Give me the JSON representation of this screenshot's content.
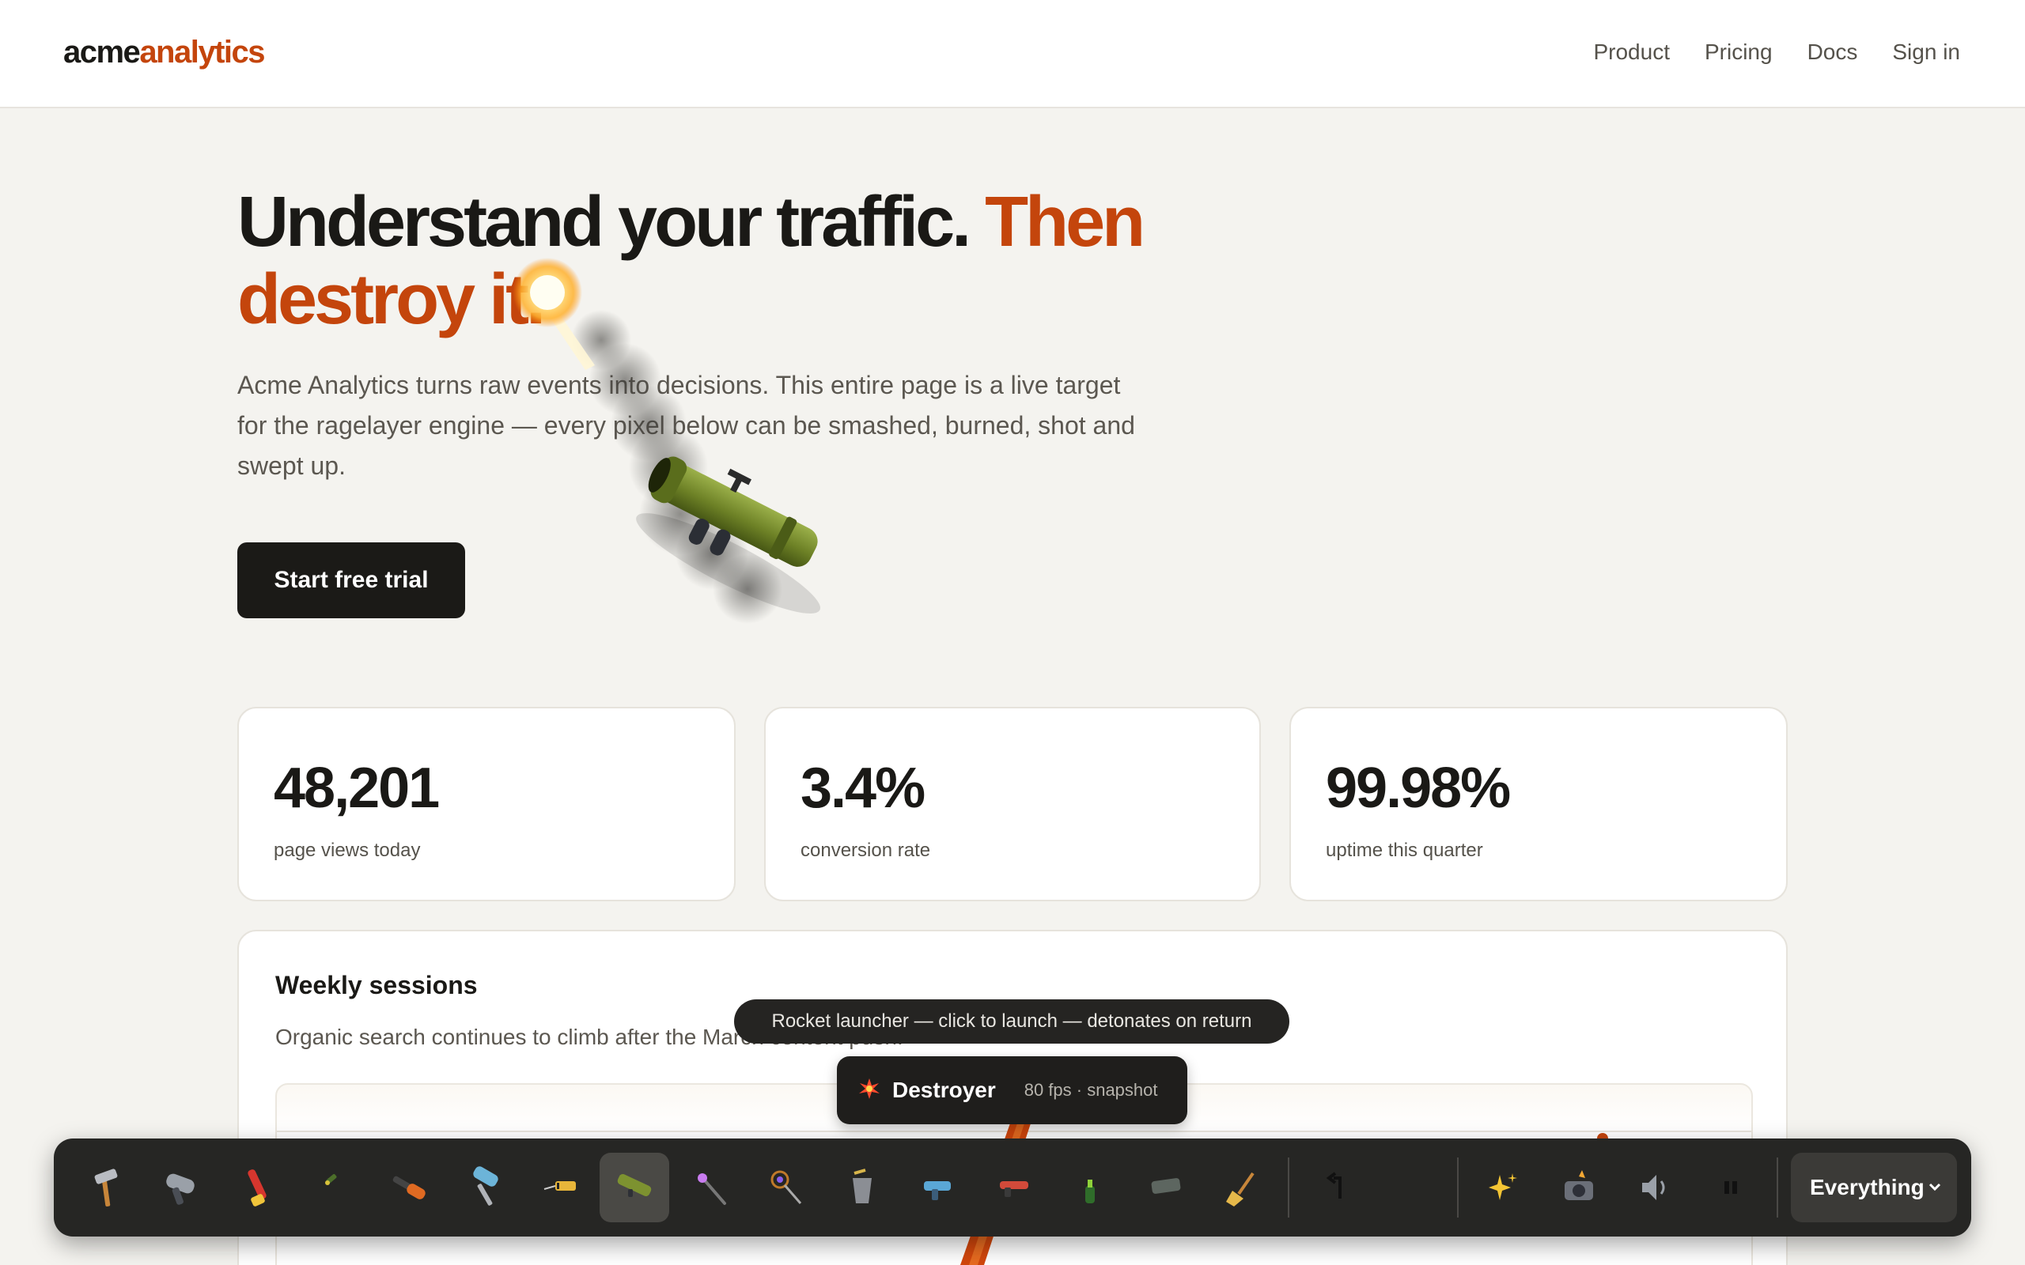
{
  "nav": {
    "logo_main": "acme",
    "logo_accent": "analytics",
    "links": [
      "Product",
      "Pricing",
      "Docs",
      "Sign in"
    ]
  },
  "hero": {
    "title_main": "Understand your traffic.",
    "title_accent": "Then destroy it.",
    "subtitle": "Acme Analytics turns raw events into decisions. This entire page is a live target for the ragelayer engine — every pixel below can be smashed, burned, shot and swept up.",
    "cta_label": "Start free trial"
  },
  "stats": [
    {
      "value": "48,201",
      "label": "page views today"
    },
    {
      "value": "3.4%",
      "label": "conversion rate"
    },
    {
      "value": "99.98%",
      "label": "uptime this quarter"
    }
  ],
  "weekly": {
    "title": "Weekly sessions",
    "subtitle": "Organic search continues to climb after the March content push."
  },
  "tooltip": "Rocket launcher — click to launch — detonates on return",
  "hud": {
    "name": "Destroyer",
    "meta": "80 fps · snapshot"
  },
  "toolbar": {
    "tools": [
      "hammer-icon",
      "hairdryer-icon",
      "chainsaw-icon",
      "pistol-icon",
      "blowtorch-icon",
      "paint-roller-icon",
      "dynamite-icon",
      "rocket-launcher-icon",
      "magic-wand-icon",
      "lollipop-icon",
      "bucket-icon",
      "ray-gun-icon",
      "lighter-icon",
      "bottle-icon",
      "eraser-icon",
      "broom-icon"
    ],
    "active_tool": "rocket-launcher-icon",
    "secondary": [
      "undo-icon",
      "sparkles-icon",
      "camera-flash-icon",
      "speaker-icon",
      "pause-icon"
    ],
    "scope_label": "Everything"
  },
  "colors": {
    "accent": "#c4450c",
    "dark": "#1b1a17",
    "toolbar": "#262624"
  }
}
